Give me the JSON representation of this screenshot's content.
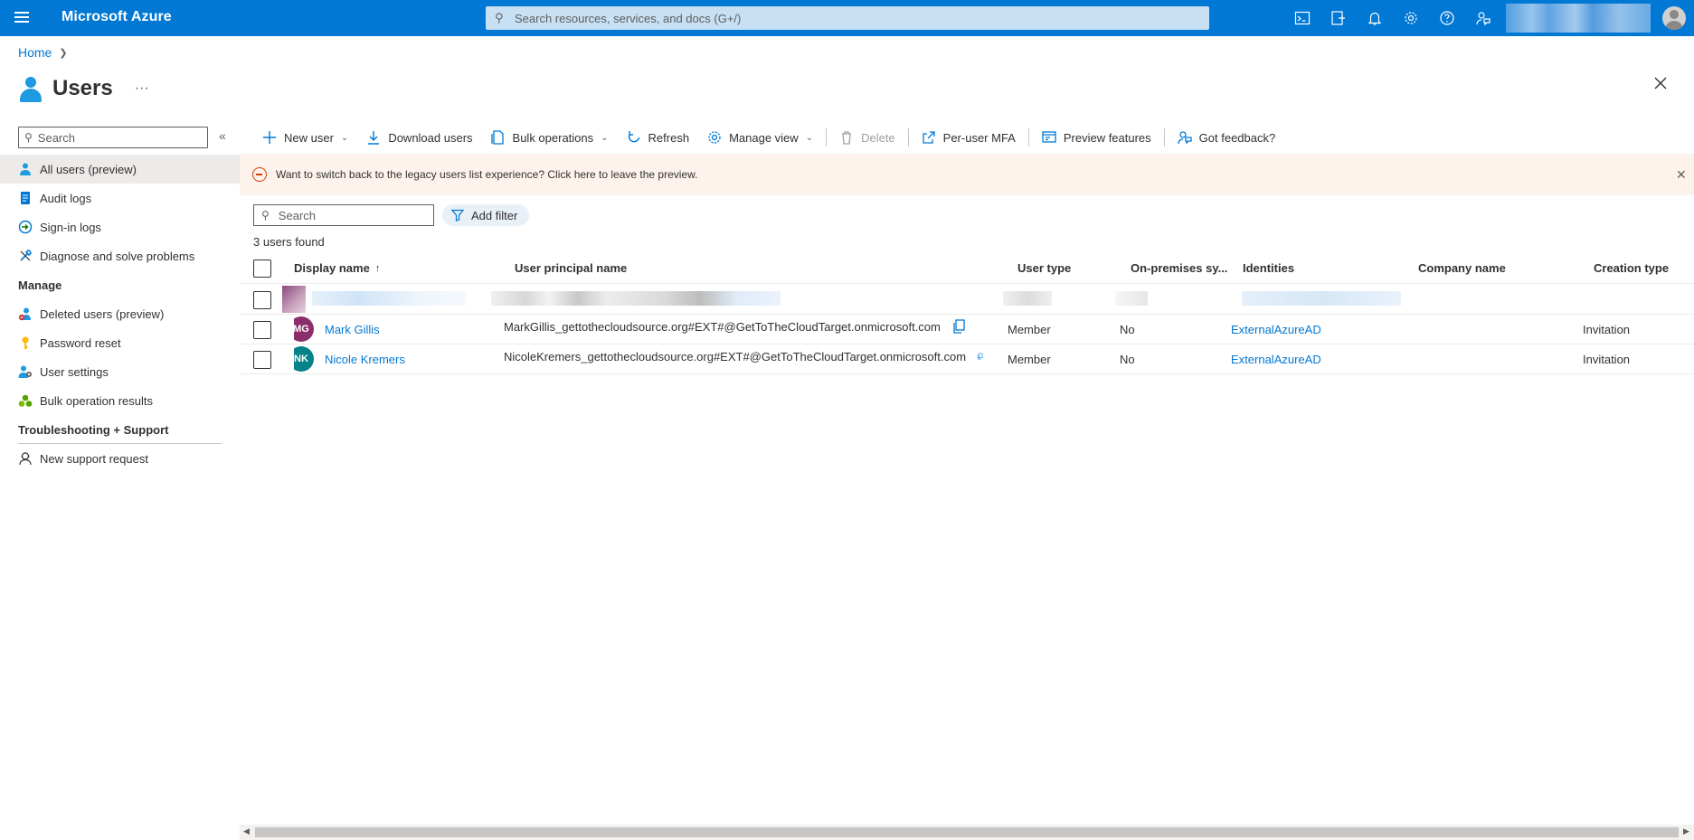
{
  "topbar": {
    "brand": "Microsoft Azure",
    "search_placeholder": "Search resources, services, and docs (G+/)",
    "icons": [
      "cloud-shell-icon",
      "directory-filter-icon",
      "notifications-icon",
      "settings-icon",
      "help-icon",
      "feedback-icon"
    ]
  },
  "breadcrumb": {
    "home": "Home"
  },
  "page": {
    "title": "Users",
    "more": "···"
  },
  "leftnav": {
    "search_placeholder": "Search",
    "items": [
      {
        "label": "All users (preview)",
        "icon": "user-icon"
      },
      {
        "label": "Audit logs",
        "icon": "audit-log-icon"
      },
      {
        "label": "Sign-in logs",
        "icon": "sign-in-icon"
      },
      {
        "label": "Diagnose and solve problems",
        "icon": "wrench-icon"
      }
    ],
    "manage_heading": "Manage",
    "manage_items": [
      {
        "label": "Deleted users (preview)",
        "icon": "deleted-user-icon"
      },
      {
        "label": "Password reset",
        "icon": "key-icon"
      },
      {
        "label": "User settings",
        "icon": "user-settings-icon"
      },
      {
        "label": "Bulk operation results",
        "icon": "bulk-results-icon"
      }
    ],
    "support_heading": "Troubleshooting + Support",
    "support_items": [
      {
        "label": "New support request",
        "icon": "support-icon"
      }
    ]
  },
  "commands": {
    "new_user": "New user",
    "download_users": "Download users",
    "bulk_operations": "Bulk operations",
    "refresh": "Refresh",
    "manage_view": "Manage view",
    "delete": "Delete",
    "per_user_mfa": "Per-user MFA",
    "preview_features": "Preview features",
    "got_feedback": "Got feedback?"
  },
  "banner": {
    "text": "Want to switch back to the legacy users list experience? Click here to leave the preview."
  },
  "list": {
    "search_placeholder": "Search",
    "add_filter": "Add filter",
    "count_text": "3 users found",
    "columns": {
      "display_name": "Display name",
      "upn": "User principal name",
      "user_type": "User type",
      "on_premises": "On-premises sy...",
      "identities": "Identities",
      "company": "Company name",
      "creation_type": "Creation type"
    },
    "rows": [
      {
        "initials": "MG",
        "avatar_color": "#8b2e6b",
        "display_name": "Mark Gillis",
        "upn": "MarkGillis_gettothecloudsource.org#EXT#@GetToTheCloudTarget.onmicrosoft.com",
        "user_type": "Member",
        "on_premises": "No",
        "identities": "ExternalAzureAD",
        "company": "",
        "creation_type": "Invitation"
      },
      {
        "initials": "NK",
        "avatar_color": "#038387",
        "display_name": "Nicole Kremers",
        "upn": "NicoleKremers_gettothecloudsource.org#EXT#@GetToTheCloudTarget.onmicrosoft.com",
        "user_type": "Member",
        "on_premises": "No",
        "identities": "ExternalAzureAD",
        "company": "",
        "creation_type": "Invitation"
      }
    ]
  },
  "colors": {
    "brand": "#0078d4",
    "banner_bg": "#fdf3ec",
    "warning": "#d83b01"
  }
}
